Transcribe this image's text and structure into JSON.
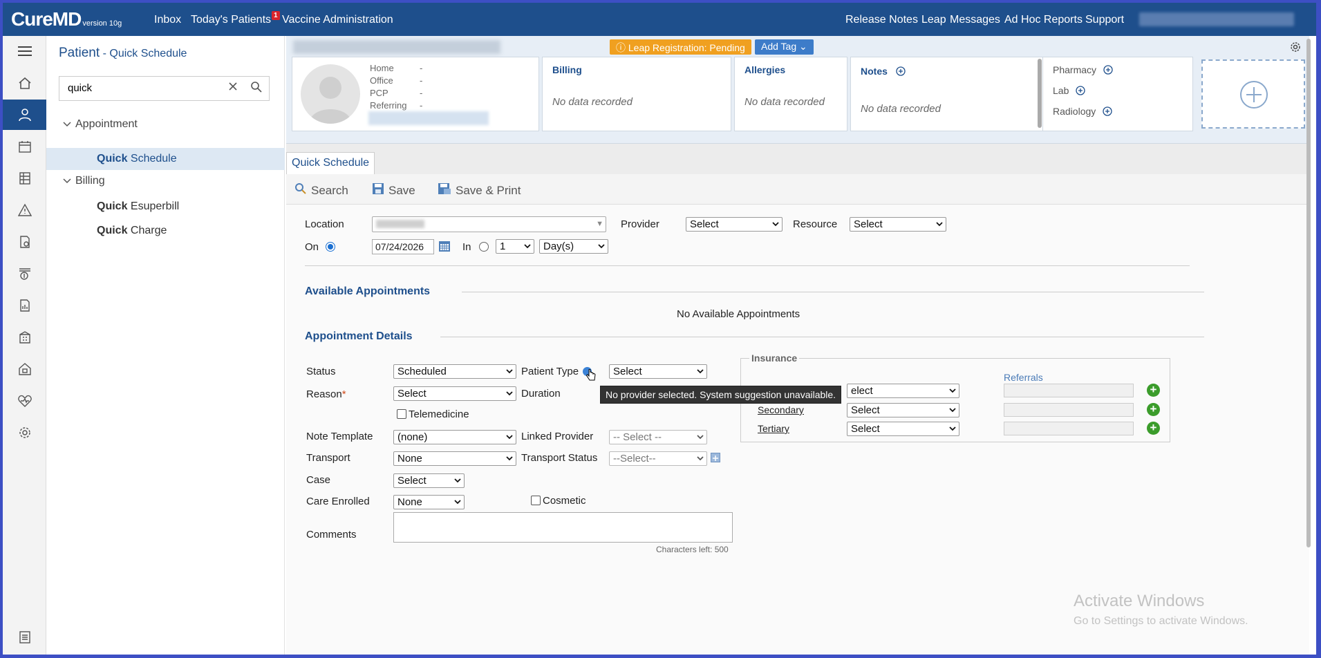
{
  "app": {
    "logo": "CureMD",
    "version": "version 10g"
  },
  "topnav": {
    "inbox": "Inbox",
    "todays_patients": "Today's Patients",
    "todays_patients_badge": "1",
    "vaccine": "Vaccine Administration",
    "release_notes": "Release Notes",
    "leap": "Leap",
    "messages": "Messages",
    "adhoc": "Ad Hoc Reports",
    "support": "Support"
  },
  "leftnav": {
    "title": "Patient",
    "subtitle": " - Quick Schedule",
    "search_value": "quick",
    "groups": [
      {
        "label": "Appointment",
        "items": [
          {
            "bold": "Quick",
            "rest": " Schedule"
          }
        ]
      },
      {
        "label": "Billing",
        "items": [
          {
            "bold": "Quick",
            "rest": " Esuperbill"
          },
          {
            "bold": "Quick",
            "rest": " Charge"
          }
        ]
      }
    ]
  },
  "patient_header": {
    "leap_status": "Leap Registration: Pending",
    "add_tag": "Add Tag",
    "contacts": [
      {
        "label": "Home",
        "value": "-"
      },
      {
        "label": "Office",
        "value": "-"
      },
      {
        "label": "PCP",
        "value": "-"
      },
      {
        "label": "Referring",
        "value": "-"
      }
    ],
    "billing_title": "Billing",
    "billing_empty": "No data recorded",
    "allergies_title": "Allergies",
    "allergies_empty": "No data recorded",
    "notes_title": "Notes",
    "notes_empty": "No data recorded",
    "pharmacy": "Pharmacy",
    "lab": "Lab",
    "radiology": "Radiology"
  },
  "tabs": {
    "active": "Quick Schedule"
  },
  "toolbar": {
    "search": "Search",
    "save": "Save",
    "save_print": "Save & Print"
  },
  "form": {
    "location_label": "Location",
    "provider_label": "Provider",
    "provider_value": "Select",
    "resource_label": "Resource",
    "resource_value": "Select",
    "on_label": "On",
    "date_value": "07/24/2026",
    "in_label": "In",
    "in_count": "1",
    "in_unit": "Day(s)"
  },
  "available": {
    "title": "Available Appointments",
    "empty": "No Available Appointments"
  },
  "details": {
    "title": "Appointment Details",
    "status_label": "Status",
    "status_value": "Scheduled",
    "patient_type_label": "Patient Type",
    "patient_type_value": "Select",
    "reason_label": "Reason",
    "reason_required": "*",
    "reason_value": "Select",
    "duration_label": "Duration",
    "telemedicine_label": "Telemedicine",
    "note_template_label": "Note Template",
    "note_template_value": "(none)",
    "linked_provider_label": "Linked Provider",
    "linked_provider_value": "-- Select --",
    "transport_label": "Transport",
    "transport_value": "None",
    "transport_status_label": "Transport Status",
    "transport_status_value": "--Select--",
    "case_label": "Case",
    "case_value": "Select",
    "care_enrolled_label": "Care Enrolled",
    "care_enrolled_value": "None",
    "cosmetic_label": "Cosmetic",
    "comments_label": "Comments",
    "chars_left": "Characters left: 500",
    "tooltip": "No provider selected. System suggestion unavailable."
  },
  "insurance": {
    "title": "Insurance",
    "referrals_label": "Referrals",
    "primary_value": "elect",
    "secondary_label": "Secondary",
    "secondary_value": "Select",
    "tertiary_label": "Tertiary",
    "tertiary_value": "Select"
  },
  "watermark": {
    "line1": "Activate Windows",
    "line2": "Go to Settings to activate Windows."
  },
  "colors": {
    "brand": "#1e4f8c",
    "leap_badge": "#f0a020",
    "add_tag": "#3d7cc9",
    "notification": "#d9242b",
    "add_green": "#3b9c2b"
  }
}
